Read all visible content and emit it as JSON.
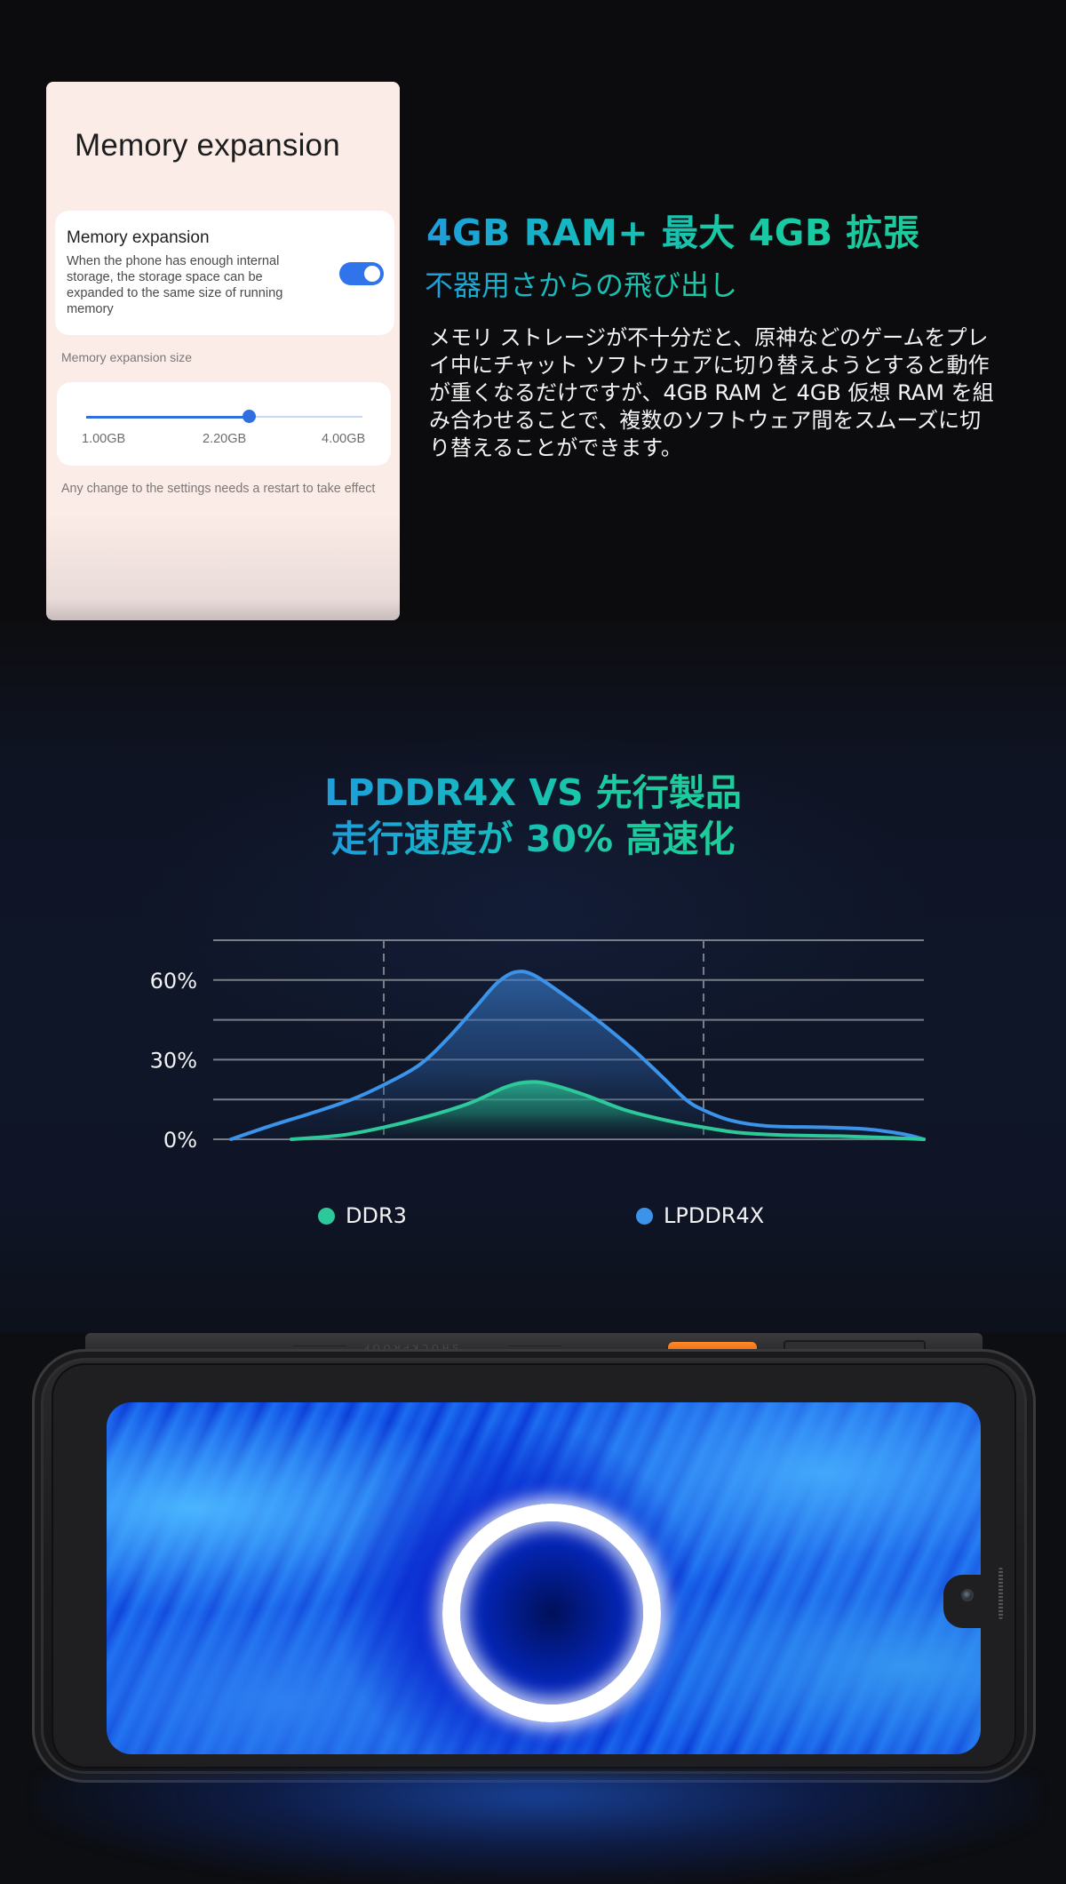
{
  "settings_screen": {
    "title": "Memory expansion",
    "toggle_card": {
      "title": "Memory expansion",
      "description": "When the phone has enough internal storage, the storage space can be expanded to the same size of running memory",
      "enabled": true
    },
    "section_label": "Memory expansion size",
    "slider": {
      "min_label": "1.00GB",
      "value_label": "2.20GB",
      "max_label": "4.00GB",
      "min": 1.0,
      "max": 4.0,
      "value": 2.2
    },
    "restart_note": "Any change to the settings needs a restart to take effect"
  },
  "headline": {
    "title": "4GB RAM+ 最大 4GB 拡張",
    "subtitle": "不器用さからの飛び出し",
    "body": "メモリ ストレージが不十分だと、原神などのゲームをプレイ中にチャット ソフトウェアに切り替えようとすると動作が重くなるだけですが、4GB RAM と 4GB 仮想 RAM を組み合わせることで、複数のソフトウェア間をスムーズに切り替えることができます。"
  },
  "chart_section": {
    "title_line1": "LPDDR4X VS 先行製品",
    "title_line2": "走行速度が 30% 高速化"
  },
  "colors": {
    "accent_blue": "#1e9ddc",
    "accent_green": "#1bcb9c",
    "ddr3": "#2ec99a",
    "lpddr4x": "#3b93ea",
    "toggle_on": "#2f74ea"
  },
  "chart_data": {
    "type": "area",
    "title": "LPDDR4X VS 先行製品 走行速度が 30% 高速化",
    "xlabel": "",
    "ylabel": "",
    "ylim": [
      0,
      75
    ],
    "y_ticks": [
      0,
      15,
      30,
      45,
      60,
      75
    ],
    "y_tick_labels": [
      {
        "value": 0,
        "label": "0%"
      },
      {
        "value": 30,
        "label": "30%"
      },
      {
        "value": 60,
        "label": "60%"
      }
    ],
    "x_range": [
      0,
      100
    ],
    "x_reference_lines": [
      24,
      69
    ],
    "grid": true,
    "legend_position": "bottom",
    "series": [
      {
        "name": "DDR3",
        "color": "#2ec99a",
        "points": [
          [
            11,
            0
          ],
          [
            18,
            1.5
          ],
          [
            24,
            4.5
          ],
          [
            30,
            8.5
          ],
          [
            36,
            13.5
          ],
          [
            41,
            19.5
          ],
          [
            44,
            21.5
          ],
          [
            47,
            21
          ],
          [
            52,
            17
          ],
          [
            58,
            11
          ],
          [
            64,
            7
          ],
          [
            69,
            4.5
          ],
          [
            74,
            2.5
          ],
          [
            80,
            1.6
          ],
          [
            88,
            1.2
          ],
          [
            95,
            0.6
          ],
          [
            100,
            0
          ]
        ]
      },
      {
        "name": "LPDDR4X",
        "color": "#3b93ea",
        "points": [
          [
            2.5,
            0
          ],
          [
            8,
            5
          ],
          [
            14,
            10
          ],
          [
            19.5,
            15
          ],
          [
            24,
            20.5
          ],
          [
            29,
            28
          ],
          [
            33,
            38
          ],
          [
            37,
            50
          ],
          [
            40,
            59
          ],
          [
            42.5,
            63
          ],
          [
            45,
            62
          ],
          [
            49,
            55
          ],
          [
            54,
            45
          ],
          [
            59,
            34
          ],
          [
            63,
            24
          ],
          [
            66.5,
            15
          ],
          [
            69,
            11
          ],
          [
            73,
            7
          ],
          [
            78,
            5
          ],
          [
            86,
            4.5
          ],
          [
            92,
            3.8
          ],
          [
            97,
            2
          ],
          [
            100,
            0
          ]
        ]
      }
    ]
  },
  "device": {
    "description": "Rugged smartphone in landscape with blue swirl wallpaper and glowing white ring"
  }
}
